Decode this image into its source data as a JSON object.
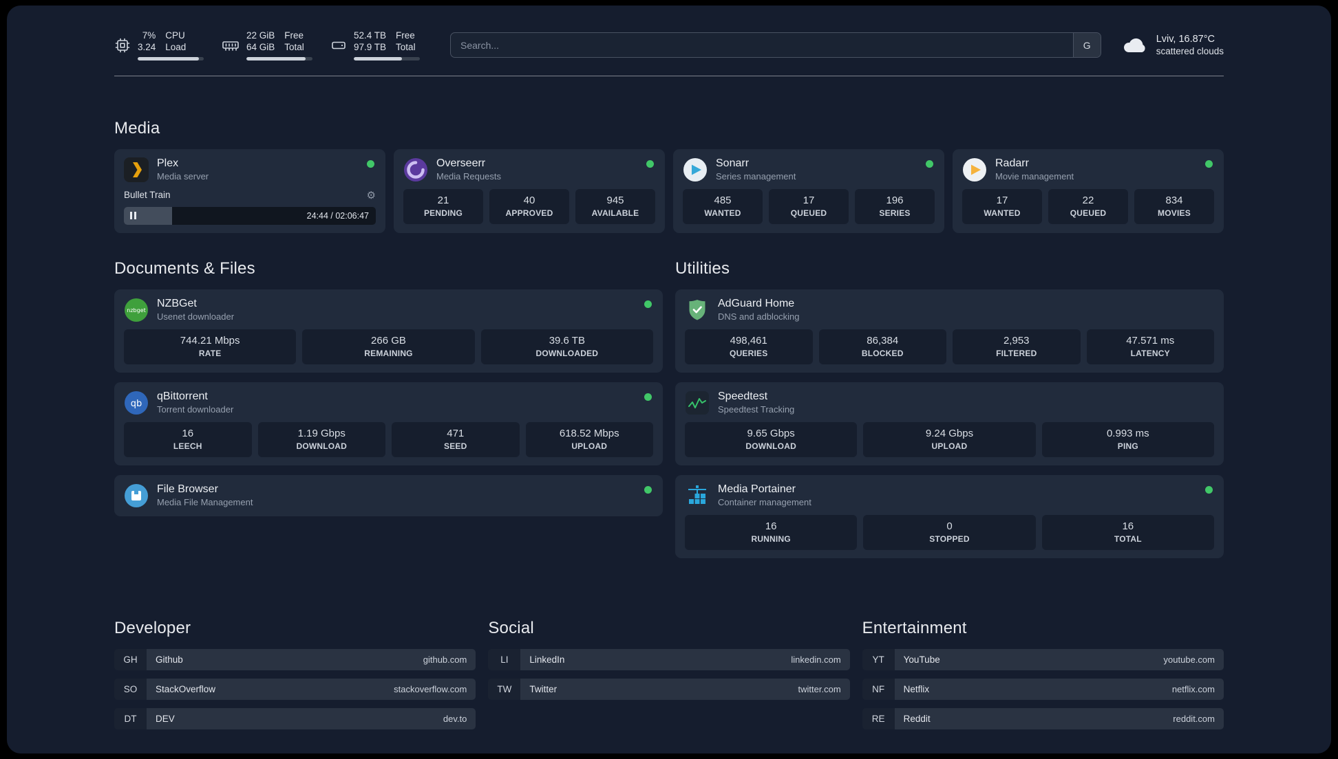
{
  "topbar": {
    "cpu": {
      "percent": "7%",
      "load": "3.24",
      "label_top": "CPU",
      "label_bottom": "Load",
      "bar_pct": 93
    },
    "memory": {
      "free": "22 GiB",
      "total": "64 GiB",
      "label_top": "Free",
      "label_bottom": "Total",
      "bar_pct": 90
    },
    "disk": {
      "free": "52.4 TB",
      "total": "97.9 TB",
      "label_top": "Free",
      "label_bottom": "Total",
      "bar_pct": 73
    },
    "search": {
      "placeholder": "Search...",
      "provider": "G"
    },
    "weather": {
      "location": "Lviv, 16.87°C",
      "condition": "scattered clouds"
    }
  },
  "media": {
    "title": "Media",
    "plex": {
      "name": "Plex",
      "desc": "Media server",
      "now_playing": "Bullet Train",
      "time": "24:44 / 02:06:47",
      "progress_pct": 19
    },
    "overseerr": {
      "name": "Overseerr",
      "desc": "Media Requests",
      "stats": [
        {
          "value": "21",
          "label": "PENDING"
        },
        {
          "value": "40",
          "label": "APPROVED"
        },
        {
          "value": "945",
          "label": "AVAILABLE"
        }
      ]
    },
    "sonarr": {
      "name": "Sonarr",
      "desc": "Series management",
      "stats": [
        {
          "value": "485",
          "label": "WANTED"
        },
        {
          "value": "17",
          "label": "QUEUED"
        },
        {
          "value": "196",
          "label": "SERIES"
        }
      ]
    },
    "radarr": {
      "name": "Radarr",
      "desc": "Movie management",
      "stats": [
        {
          "value": "17",
          "label": "WANTED"
        },
        {
          "value": "22",
          "label": "QUEUED"
        },
        {
          "value": "834",
          "label": "MOVIES"
        }
      ]
    }
  },
  "documents": {
    "title": "Documents & Files",
    "nzbget": {
      "name": "NZBGet",
      "desc": "Usenet downloader",
      "stats": [
        {
          "value": "744.21 Mbps",
          "label": "RATE"
        },
        {
          "value": "266 GB",
          "label": "REMAINING"
        },
        {
          "value": "39.6 TB",
          "label": "DOWNLOADED"
        }
      ]
    },
    "qbittorrent": {
      "name": "qBittorrent",
      "desc": "Torrent downloader",
      "stats": [
        {
          "value": "16",
          "label": "LEECH"
        },
        {
          "value": "1.19 Gbps",
          "label": "DOWNLOAD"
        },
        {
          "value": "471",
          "label": "SEED"
        },
        {
          "value": "618.52 Mbps",
          "label": "UPLOAD"
        }
      ]
    },
    "filebrowser": {
      "name": "File Browser",
      "desc": "Media File Management"
    }
  },
  "utilities": {
    "title": "Utilities",
    "adguard": {
      "name": "AdGuard Home",
      "desc": "DNS and adblocking",
      "stats": [
        {
          "value": "498,461",
          "label": "QUERIES"
        },
        {
          "value": "86,384",
          "label": "BLOCKED"
        },
        {
          "value": "2,953",
          "label": "FILTERED"
        },
        {
          "value": "47.571 ms",
          "label": "LATENCY"
        }
      ]
    },
    "speedtest": {
      "name": "Speedtest",
      "desc": "Speedtest Tracking",
      "stats": [
        {
          "value": "9.65 Gbps",
          "label": "DOWNLOAD"
        },
        {
          "value": "9.24 Gbps",
          "label": "UPLOAD"
        },
        {
          "value": "0.993 ms",
          "label": "PING"
        }
      ]
    },
    "portainer": {
      "name": "Media Portainer",
      "desc": "Container management",
      "stats": [
        {
          "value": "16",
          "label": "RUNNING"
        },
        {
          "value": "0",
          "label": "STOPPED"
        },
        {
          "value": "16",
          "label": "TOTAL"
        }
      ]
    }
  },
  "bookmarks": {
    "developer": {
      "title": "Developer",
      "items": [
        {
          "abbr": "GH",
          "name": "Github",
          "domain": "github.com"
        },
        {
          "abbr": "SO",
          "name": "StackOverflow",
          "domain": "stackoverflow.com"
        },
        {
          "abbr": "DT",
          "name": "DEV",
          "domain": "dev.to"
        }
      ]
    },
    "social": {
      "title": "Social",
      "items": [
        {
          "abbr": "LI",
          "name": "LinkedIn",
          "domain": "linkedin.com"
        },
        {
          "abbr": "TW",
          "name": "Twitter",
          "domain": "twitter.com"
        }
      ]
    },
    "entertainment": {
      "title": "Entertainment",
      "items": [
        {
          "abbr": "YT",
          "name": "YouTube",
          "domain": "youtube.com"
        },
        {
          "abbr": "NF",
          "name": "Netflix",
          "domain": "netflix.com"
        },
        {
          "abbr": "RE",
          "name": "Reddit",
          "domain": "reddit.com"
        }
      ]
    }
  }
}
